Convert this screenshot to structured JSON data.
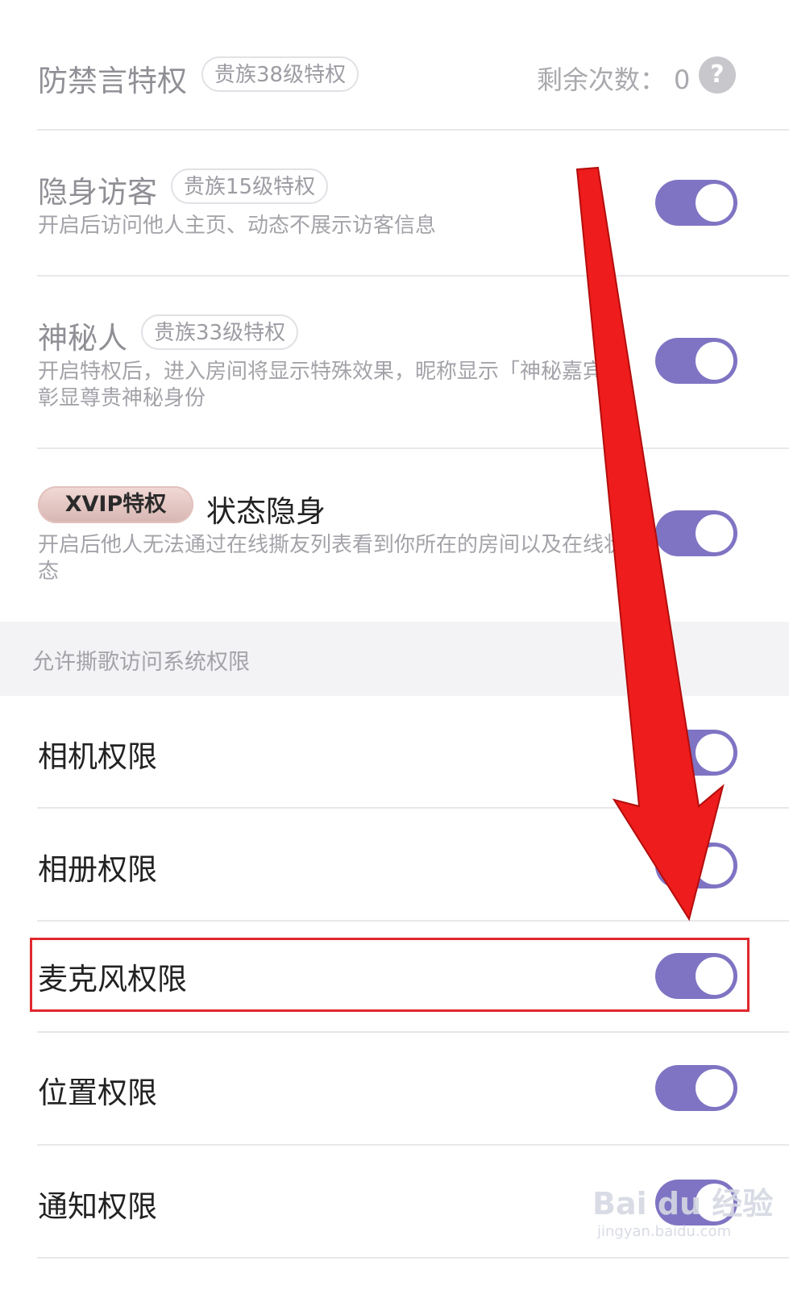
{
  "anti_mute": {
    "title": "防禁言特权",
    "tag": "贵族38级特权",
    "remaining_label": "剩余次数：",
    "remaining_count": "0",
    "help_glyph": "?"
  },
  "privileges": [
    {
      "title": "隐身访客",
      "tag": "贵族15级特权",
      "description": "开启后访问他人主页、动态不展示访客信息",
      "enabled": true
    },
    {
      "title": "神秘人",
      "tag": "贵族33级特权",
      "description": "开启特权后，进入房间将显示特殊效果，昵称显示「神秘嘉宾」，彰显尊贵神秘身份",
      "enabled": true
    },
    {
      "badge": "XVIP特权",
      "title": "状态隐身",
      "description": "开启后他人无法通过在线撕友列表看到你所在的房间以及在线状态",
      "enabled": true
    }
  ],
  "permissions_section": {
    "header": "允许撕歌访问系统权限",
    "items": [
      {
        "label": "相机权限",
        "enabled": true
      },
      {
        "label": "相册权限",
        "enabled": true
      },
      {
        "label": "麦克风权限",
        "enabled": true,
        "highlighted": true
      },
      {
        "label": "位置权限",
        "enabled": true
      },
      {
        "label": "通知权限",
        "enabled": true
      }
    ]
  },
  "colors": {
    "toggle_on": "#7f74c3",
    "highlight": "#e0282d",
    "arrow": "#ee1c1c"
  },
  "annotation": {
    "arrow_icon": "red-arrow-pointing-down"
  },
  "watermark": {
    "main": "Bai du 经验",
    "sub": "jingyan.baidu.com"
  }
}
